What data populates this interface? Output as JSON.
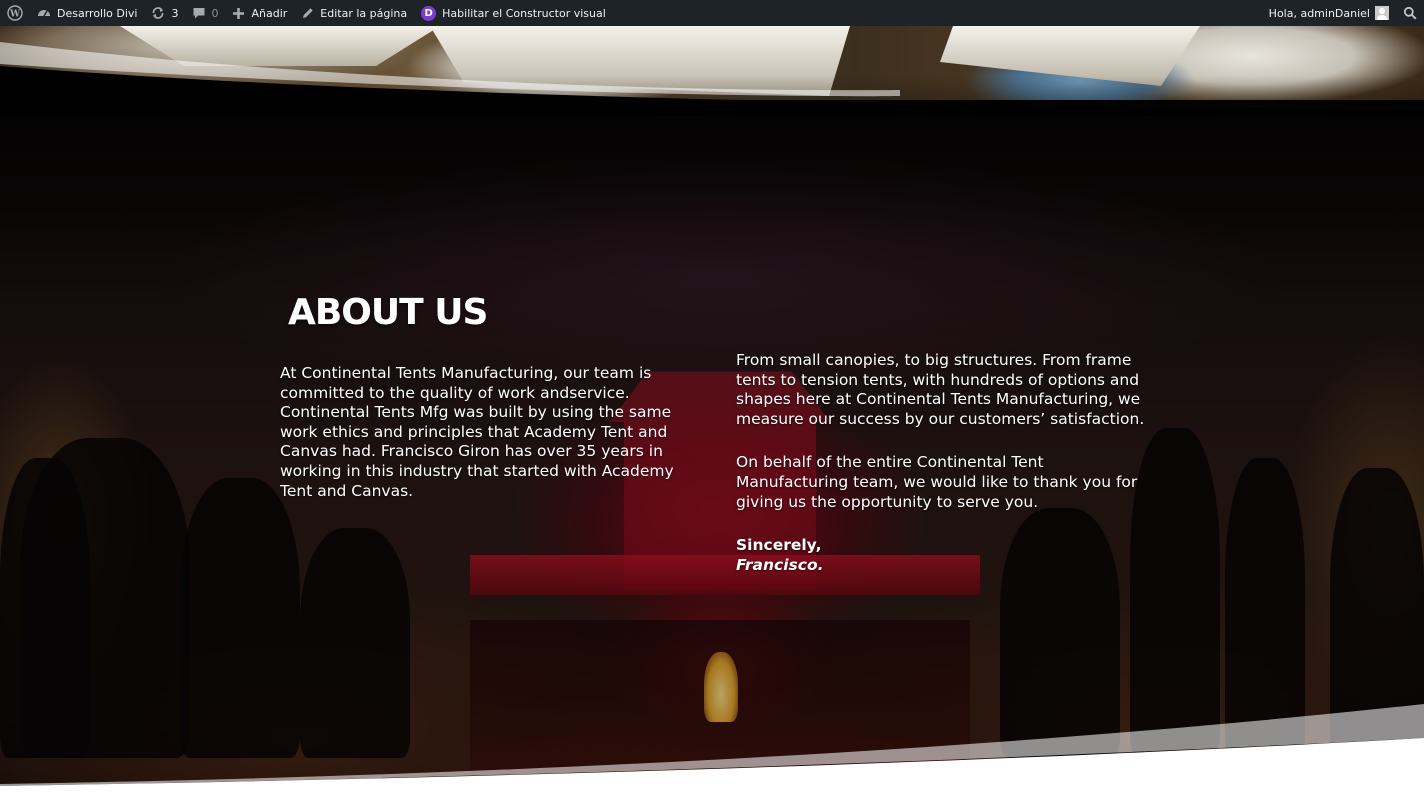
{
  "admin_bar": {
    "site_name": "Desarrollo Divi",
    "updates_count": "3",
    "comments_count": "0",
    "new_label": "Añadir",
    "edit_label": "Editar la página",
    "divi_badge": "D",
    "builder_label": "Habilitar el Constructor visual",
    "greeting": "Hola, adminDaniel",
    "icons": [
      "wordpress-logo-icon",
      "dashboard-icon",
      "refresh-icon",
      "comment-icon",
      "plus-icon",
      "pencil-icon",
      "divi-icon",
      "avatar-icon",
      "search-icon"
    ]
  },
  "about": {
    "title": "ABOUT US",
    "left_paragraph": "At Continental Tents Manufacturing, our team is committed to the quality of work andservice. Continental Tents Mfg was built by using the same work ethics and principles that Academy Tent and Canvas had. Francisco Giron has over 35 years in working in this industry that started with Academy Tent and Canvas.",
    "right_paragraph_1": "From small canopies, to big structures. From frame tents to tension tents, with hundreds of options and shapes here at Continental Tents Manufacturing, we measure our success by our customers’ satisfaction.",
    "right_paragraph_2": "On behalf of the entire Continental Tent Manufacturing team, we would like to thank you for giving us the opportunity to serve you.",
    "sign_off": "Sincerely,",
    "signature": "Francisco."
  },
  "colors": {
    "admin_bar_bg": "#1d2327",
    "divi_purple": "#7e3bd0",
    "text": "#ffffff",
    "divider": "#ffffff"
  }
}
